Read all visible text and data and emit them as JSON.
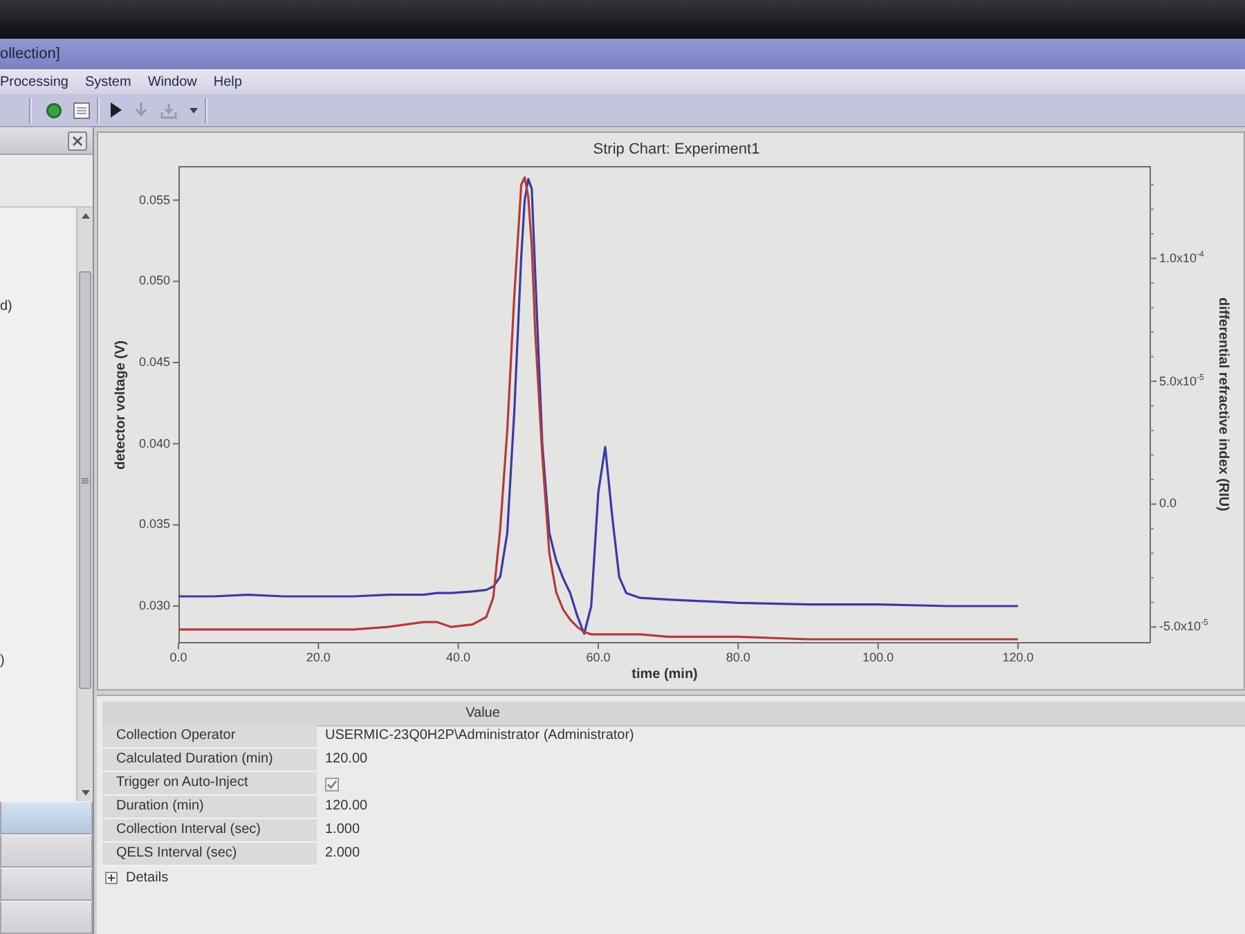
{
  "window": {
    "title": "ollection]"
  },
  "menu": [
    "Processing",
    "System",
    "Window",
    "Help"
  ],
  "toolbar": [
    {
      "kind": "record",
      "disabled": false
    },
    {
      "kind": "sheet",
      "disabled": false
    },
    {
      "kind": "play",
      "disabled": false
    },
    {
      "kind": "down",
      "disabled": true
    },
    {
      "kind": "tray",
      "disabled": true
    }
  ],
  "side_panel": {
    "items": [
      "d)",
      ")"
    ],
    "nav_buttons": [
      {
        "selected": true
      },
      {
        "selected": false
      },
      {
        "selected": false
      },
      {
        "selected": false
      }
    ]
  },
  "chart": {
    "chart_data": {
      "type": "line",
      "title": "Strip Chart: Experiment1",
      "xlabel": "time (min)",
      "ylabel": "detector voltage (V)",
      "y2label": "differential refractive index (RIU)",
      "x": [
        0,
        5,
        10,
        15,
        20,
        25,
        30,
        35,
        37,
        39,
        42,
        44,
        45,
        46,
        47,
        48,
        49,
        49.5,
        50,
        50.5,
        51,
        52,
        53,
        54,
        55,
        56,
        57,
        58,
        59,
        60,
        61,
        62,
        63,
        64,
        66,
        70,
        80,
        90,
        100,
        110,
        120
      ],
      "series": [
        {
          "color": "#3a3aa6",
          "axis": "y",
          "values": [
            0.0306,
            0.0306,
            0.0307,
            0.0306,
            0.0306,
            0.0306,
            0.0307,
            0.0307,
            0.0308,
            0.0308,
            0.0309,
            0.031,
            0.0312,
            0.0318,
            0.0345,
            0.042,
            0.0515,
            0.055,
            0.0563,
            0.0557,
            0.0505,
            0.04,
            0.0345,
            0.0328,
            0.0317,
            0.0308,
            0.0294,
            0.0283,
            0.03,
            0.037,
            0.0398,
            0.0355,
            0.0318,
            0.0308,
            0.0305,
            0.0304,
            0.0302,
            0.0301,
            0.0301,
            0.03,
            0.03
          ]
        },
        {
          "color": "#b63a3a",
          "axis": "y2",
          "values": [
            -5.1e-05,
            -5.1e-05,
            -5.1e-05,
            -5.1e-05,
            -5.1e-05,
            -5.1e-05,
            -5e-05,
            -4.8e-05,
            -4.8e-05,
            -5e-05,
            -4.9e-05,
            -4.6e-05,
            -3.8e-05,
            -1e-05,
            3e-05,
            8.5e-05,
            0.00013,
            0.000133,
            0.000125,
            0.000105,
            7e-05,
            2e-05,
            -2e-05,
            -3.6e-05,
            -4.3e-05,
            -4.7e-05,
            -5e-05,
            -5.2e-05,
            -5.3e-05,
            -5.3e-05,
            -5.3e-05,
            -5.3e-05,
            -5.3e-05,
            -5.3e-05,
            -5.3e-05,
            -5.4e-05,
            -5.4e-05,
            -5.5e-05,
            -5.5e-05,
            -5.5e-05,
            -5.5e-05
          ]
        }
      ],
      "xlim": [
        0,
        139
      ],
      "ylim": [
        0.0277,
        0.0571
      ],
      "y2lim": [
        -5.67e-05,
        0.0001376
      ],
      "xticks": [
        {
          "value": 0,
          "label": "0.0"
        },
        {
          "value": 20,
          "label": "20.0"
        },
        {
          "value": 40,
          "label": "40.0"
        },
        {
          "value": 60,
          "label": "60.0"
        },
        {
          "value": 80,
          "label": "80.0"
        },
        {
          "value": 100,
          "label": "100.0"
        },
        {
          "value": 120,
          "label": "120.0"
        }
      ],
      "yticks": [
        {
          "value": 0.03,
          "label": "0.030"
        },
        {
          "value": 0.035,
          "label": "0.035"
        },
        {
          "value": 0.04,
          "label": "0.040"
        },
        {
          "value": 0.045,
          "label": "0.045"
        },
        {
          "value": 0.05,
          "label": "0.050"
        },
        {
          "value": 0.055,
          "label": "0.055"
        }
      ],
      "y2ticks": [
        {
          "value": -5e-05,
          "label": "-5.0x10$^{-5}$"
        },
        {
          "value": 0,
          "label": "0.0"
        },
        {
          "value": 5e-05,
          "label": "5.0x10$^{-5}$"
        },
        {
          "value": 0.0001,
          "label": "1.0x10$^{-4}$"
        }
      ]
    }
  },
  "properties": {
    "header": "Value",
    "rows": [
      {
        "kind": "text",
        "label": "Collection Operator",
        "value": "USERMIC-23Q0H2P\\Administrator (Administrator)"
      },
      {
        "kind": "text",
        "label": "Calculated Duration (min)",
        "value": "120.00"
      },
      {
        "kind": "checkbox",
        "label": "Trigger on Auto-Inject",
        "checked": true
      },
      {
        "kind": "text",
        "label": "Duration (min)",
        "value": "120.00"
      },
      {
        "kind": "text",
        "label": "Collection Interval (sec)",
        "value": "1.000"
      },
      {
        "kind": "text",
        "label": "QELS Interval (sec)",
        "value": "2.000"
      }
    ],
    "details": {
      "label": "Details",
      "expanded": false
    }
  }
}
